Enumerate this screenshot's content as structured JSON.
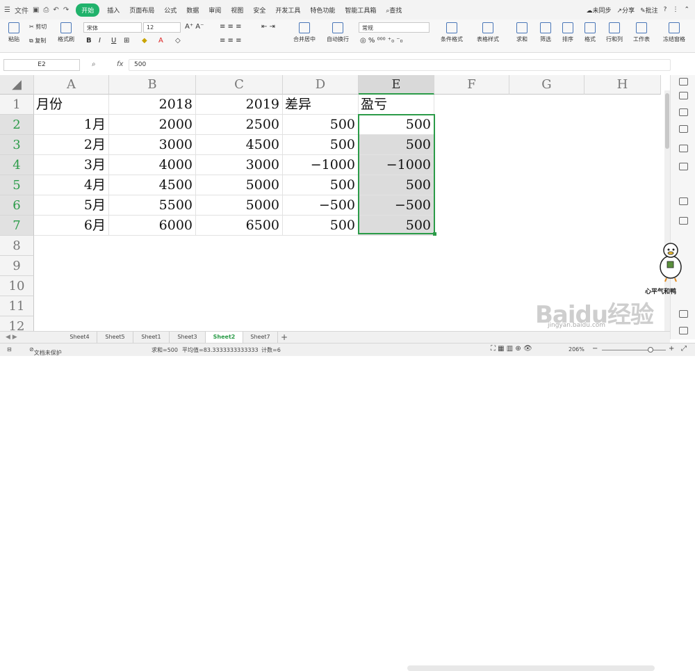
{
  "menubar": {
    "file": "文件",
    "items": [
      "开始",
      "插入",
      "页面布局",
      "公式",
      "数据",
      "审阅",
      "视图",
      "安全",
      "开发工具",
      "特色功能",
      "智能工具箱"
    ],
    "active_index": 0,
    "search": "查找",
    "sync": "未同步",
    "share": "分享",
    "comment": "批注"
  },
  "ribbon": {
    "paste": "粘贴",
    "cut": "剪切",
    "copy": "复制",
    "format_painter": "格式刷",
    "font_name": "宋体",
    "font_size": "12",
    "merge": "合并居中",
    "wrap": "自动换行",
    "number_format": "常规",
    "cond_format": "条件格式",
    "table_style": "表格样式",
    "sum": "求和",
    "filter": "筛选",
    "sort": "排序",
    "format": "格式",
    "rowcol": "行和列",
    "sheet": "工作表",
    "freeze": "冻结窗格"
  },
  "formula_bar": {
    "name_box": "E2",
    "fx": "fx",
    "value": "500"
  },
  "columns": [
    "A",
    "B",
    "C",
    "D",
    "E",
    "F",
    "G",
    "H"
  ],
  "rows": [
    "1",
    "2",
    "3",
    "4",
    "5",
    "6",
    "7",
    "8",
    "9",
    "10",
    "11",
    "12"
  ],
  "cells": [
    [
      "月份",
      "2018",
      "2019",
      "差异",
      "盈亏"
    ],
    [
      "1月",
      "2000",
      "2500",
      "500",
      "500"
    ],
    [
      "2月",
      "3000",
      "4500",
      "500",
      "500"
    ],
    [
      "3月",
      "4000",
      "3000",
      "−1000",
      "−1000"
    ],
    [
      "4月",
      "4500",
      "5000",
      "500",
      "500"
    ],
    [
      "5月",
      "5500",
      "5000",
      "−500",
      "−500"
    ],
    [
      "6月",
      "6000",
      "6500",
      "500",
      "500"
    ]
  ],
  "sheets": [
    "Sheet4",
    "Sheet5",
    "Sheet1",
    "Sheet3",
    "Sheet2",
    "Sheet7"
  ],
  "active_sheet": "Sheet2",
  "status": {
    "protect": "文档未保护",
    "sum": "求和=500",
    "avg": "平均值=83.3333333333333",
    "count": "计数=6",
    "zoom": "206%"
  },
  "watermark": {
    "brand": "Baidu经验",
    "url": "jingyan.baidu.com",
    "stamp": "心平气和鸭"
  },
  "colors": {
    "accent": "#2b9b48",
    "tab_active": "#20b26b"
  }
}
